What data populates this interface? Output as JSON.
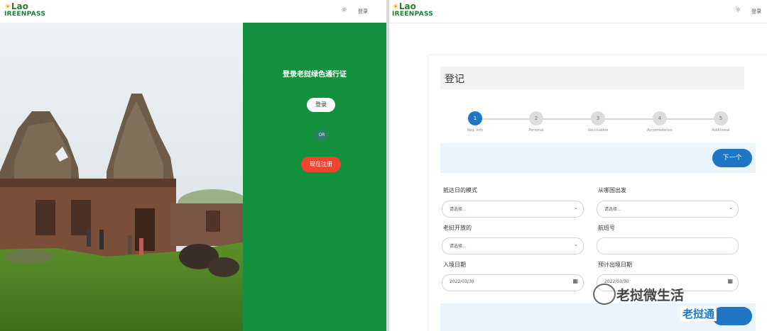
{
  "brand": {
    "line1": "Lao",
    "line2": "IREENPASS"
  },
  "left": {
    "nav": {
      "gear": "☼",
      "login": "登录"
    },
    "title": "登录老挝绿色通行证",
    "login_button": "登录",
    "or_label": "OR",
    "register_button": "现在注册"
  },
  "right": {
    "nav": {
      "gear": "☼",
      "login": "登录"
    },
    "card_title": "登记",
    "steps": [
      {
        "num": "1",
        "label": "Req. Info"
      },
      {
        "num": "2",
        "label": "Personal"
      },
      {
        "num": "3",
        "label": "Vaccination"
      },
      {
        "num": "4",
        "label": "Accomodation"
      },
      {
        "num": "5",
        "label": "Additional"
      }
    ],
    "next_button": "下一个",
    "fields": {
      "arrival_mode": {
        "label": "抵达日的模式",
        "value": "请选择..."
      },
      "from_country": {
        "label": "从哪国出发",
        "value": "请选择..."
      },
      "lao_entry": {
        "label": "老挝开放的",
        "value": "请选择..."
      },
      "flight_no": {
        "label": "航班号",
        "value": ""
      },
      "entry_date": {
        "label": "入境日期",
        "value": "2022/03/30"
      },
      "exit_date": {
        "label": "预计出境日期",
        "value": "2022/03/30"
      }
    }
  },
  "watermark": {
    "text": "老挝微生活",
    "logo": "老挝通"
  },
  "colors": {
    "green": "#14913e",
    "blue": "#1f76c4",
    "red": "#f0442f"
  }
}
